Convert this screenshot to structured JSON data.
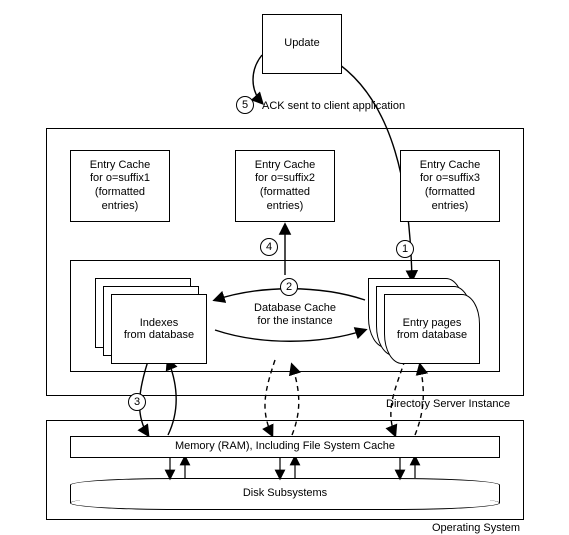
{
  "update_box": "Update",
  "entry_caches": [
    {
      "line1": "Entry Cache",
      "line2": "for o=suffix1",
      "line3": "(formatted",
      "line4": "entries)"
    },
    {
      "line1": "Entry Cache",
      "line2": "for o=suffix2",
      "line3": "(formatted",
      "line4": "entries)"
    },
    {
      "line1": "Entry Cache",
      "line2": "for o=suffix3",
      "line3": "(formatted",
      "line4": "entries)"
    }
  ],
  "db_cache": {
    "indexes_l1": "Indexes",
    "indexes_l2": "from database",
    "title": "Database Cache",
    "subtitle": "for the instance",
    "pages_l1": "Entry pages",
    "pages_l2": "from database"
  },
  "ds_label": "Directory Server Instance",
  "os": {
    "ram": "Memory (RAM), Including File System Cache",
    "disk": "Disk Subsystems",
    "label": "Operating System"
  },
  "steps": {
    "s1": "1",
    "s2": "2",
    "s3": "3",
    "s4": "4",
    "s5": "5",
    "ack": "ACK sent to client application"
  },
  "chart_data": {
    "type": "flow-diagram",
    "nodes": [
      {
        "id": "update",
        "label": "Update",
        "type": "box"
      },
      {
        "id": "ec1",
        "label": "Entry Cache for o=suffix1 (formatted entries)",
        "type": "box"
      },
      {
        "id": "ec2",
        "label": "Entry Cache for o=suffix2 (formatted entries)",
        "type": "box"
      },
      {
        "id": "ec3",
        "label": "Entry Cache for o=suffix3 (formatted entries)",
        "type": "box"
      },
      {
        "id": "dbcache",
        "label": "Database Cache for the instance",
        "type": "container",
        "children": [
          "indexes",
          "entrypages"
        ]
      },
      {
        "id": "indexes",
        "label": "Indexes from database",
        "type": "stack"
      },
      {
        "id": "entrypages",
        "label": "Entry pages from database",
        "type": "stack"
      },
      {
        "id": "dsinstance",
        "label": "Directory Server Instance",
        "type": "container",
        "children": [
          "ec1",
          "ec2",
          "ec3",
          "dbcache"
        ]
      },
      {
        "id": "ram",
        "label": "Memory (RAM), Including File System Cache",
        "type": "box"
      },
      {
        "id": "disk",
        "label": "Disk Subsystems",
        "type": "cylinder"
      },
      {
        "id": "os",
        "label": "Operating System",
        "type": "container",
        "children": [
          "ram",
          "disk"
        ]
      }
    ],
    "edges": [
      {
        "from": "update",
        "to": "entrypages",
        "step": 1,
        "style": "solid"
      },
      {
        "from": "entrypages",
        "to": "indexes",
        "step": 2,
        "style": "solid",
        "bidirectional": true
      },
      {
        "from": "indexes",
        "to": "ram",
        "step": 3,
        "style": "solid",
        "bidirectional": true
      },
      {
        "from": "ram",
        "to": "disk",
        "style": "solid",
        "bidirectional": true
      },
      {
        "from": "dbcache",
        "to": "ram",
        "style": "dashed",
        "bidirectional": true,
        "count": 2
      },
      {
        "from": "entrypages",
        "to": "ec2",
        "step": 4,
        "style": "solid"
      },
      {
        "from": "update",
        "to": "client",
        "step": 5,
        "label": "ACK sent to client application",
        "style": "solid"
      }
    ]
  }
}
